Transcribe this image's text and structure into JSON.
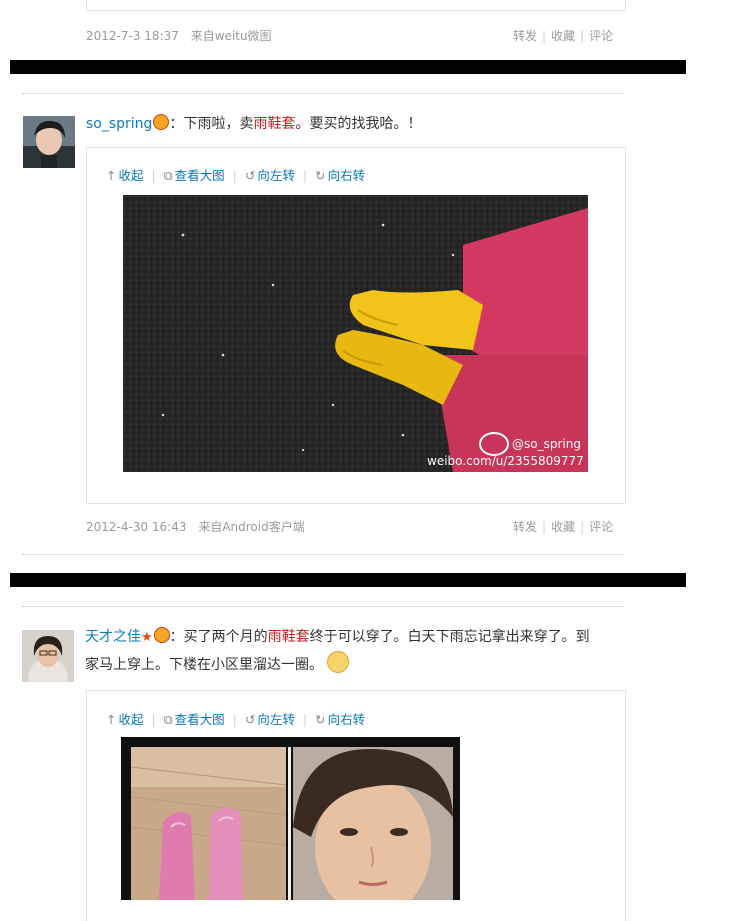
{
  "post0": {
    "date": "2012-7-3 18:37",
    "source": "来自weitu微图",
    "actions": {
      "repost": "转发",
      "favorite": "收藏",
      "comment": "评论"
    }
  },
  "post1": {
    "username": "so_spring",
    "colon": "：",
    "text_pre": "下雨啦，卖",
    "keyword": "雨鞋套",
    "text_post": "。要买的找我哈。！",
    "toolbar": {
      "collapse": "收起",
      "view_large": "查看大图",
      "rotate_left": "向左转",
      "rotate_right": "向右转"
    },
    "watermark_handle": "@so_spring",
    "watermark_url": "weibo.com/u/2355809777",
    "date": "2012-4-30 16:43",
    "source": "来自Android客户端",
    "actions": {
      "repost": "转发",
      "favorite": "收藏",
      "comment": "评论"
    }
  },
  "post2": {
    "username": "天才之佳",
    "colon": "：",
    "text_pre": "买了两个月的",
    "keyword": "雨鞋套",
    "text_post": "终于可以穿了。白天下雨忘记拿出来穿了。到",
    "text_line2": "家马上穿上。下楼在小区里溜达一圈。",
    "toolbar": {
      "collapse": "收起",
      "view_large": "查看大图",
      "rotate_left": "向左转",
      "rotate_right": "向右转"
    }
  },
  "icons": {
    "collapse": "up-arrow-icon",
    "view_large": "external-view-icon",
    "rotate_left": "rotate-left-icon",
    "rotate_right": "rotate-right-icon",
    "weibo": "weibo-logo-icon"
  },
  "colors": {
    "link": "#0a7ab8",
    "keyword": "#c2211e",
    "meta": "#9a9a9a",
    "divider_bar": "#000000",
    "boot_yellow": "#f0c419",
    "boot_pink": "#e07bb0",
    "pants_pink": "#d43a61"
  }
}
